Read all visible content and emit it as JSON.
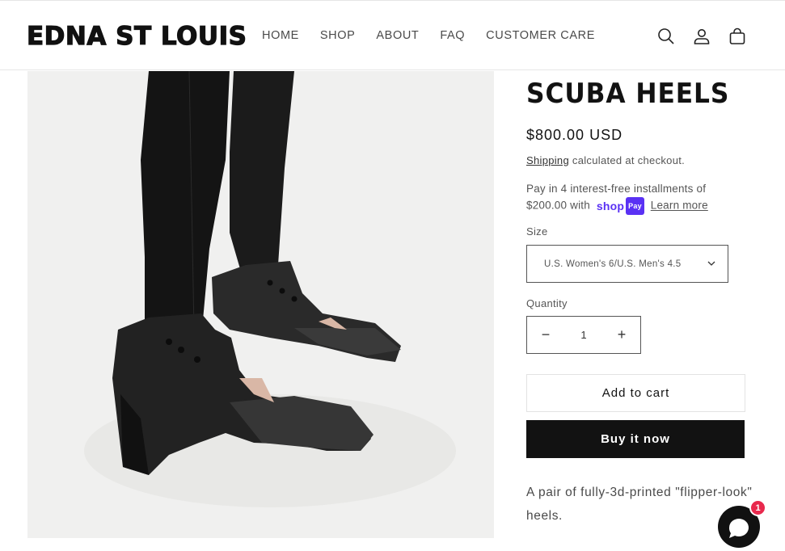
{
  "brand": {
    "logo_text": "EDNA ST LOUIS"
  },
  "nav": {
    "items": [
      {
        "label": "HOME"
      },
      {
        "label": "SHOP"
      },
      {
        "label": "ABOUT"
      },
      {
        "label": "FAQ"
      },
      {
        "label": "CUSTOMER CARE"
      }
    ]
  },
  "header_icons": [
    "search-icon",
    "account-icon",
    "cart-icon"
  ],
  "product": {
    "title": "SCUBA HEELS",
    "price": "$800.00 USD",
    "shipping_link": "Shipping",
    "shipping_text": " calculated at checkout.",
    "pay_line1": "Pay in 4 interest-free installments of",
    "pay_amount": "$200.00 with",
    "shop_pay_word": "shop",
    "shop_pay_badge": "Pay",
    "learn_more": "Learn more",
    "size_label": "Size",
    "size_selected": "U.S. Women's 6/U.S. Men's 4.5",
    "quantity_label": "Quantity",
    "quantity_value": "1",
    "minus_symbol": "−",
    "plus_symbol": "+",
    "add_to_cart": "Add to cart",
    "buy_now": "Buy it now",
    "description": "A pair of fully-3d-printed \"flipper-look\" heels."
  },
  "chat": {
    "badge_count": "1"
  },
  "colors": {
    "shop_pay": "#5a31f4",
    "buy_button": "#121212",
    "badge": "#e8294d"
  }
}
